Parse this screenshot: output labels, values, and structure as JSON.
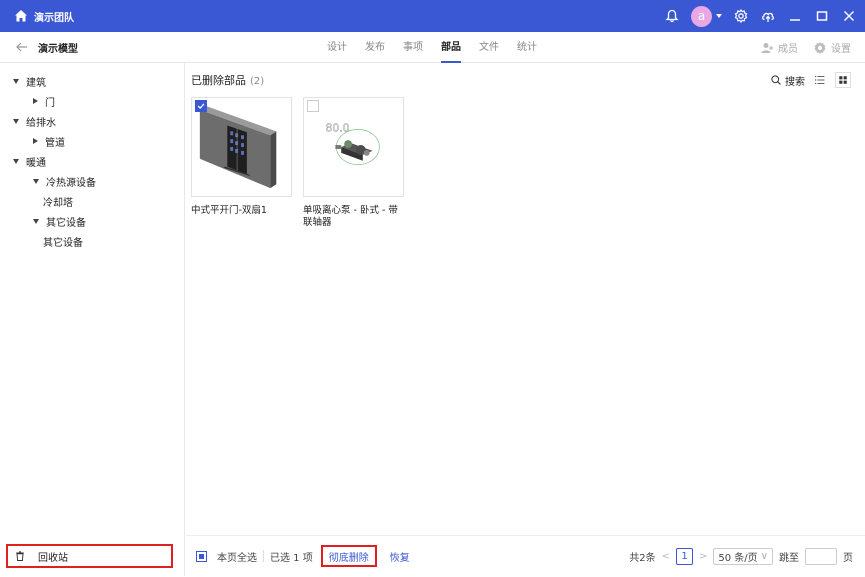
{
  "titlebar": {
    "team_name": "演示团队",
    "avatar_letter": "a",
    "icons": [
      "home-icon",
      "bell-icon",
      "chevron-down-icon",
      "gear-icon",
      "upload-cloud-icon",
      "minimize-icon",
      "maximize-icon",
      "close-icon"
    ]
  },
  "subbar": {
    "model_name": "演示模型",
    "tabs": [
      {
        "label": "设计",
        "active": false
      },
      {
        "label": "发布",
        "active": false
      },
      {
        "label": "事项",
        "active": false
      },
      {
        "label": "部品",
        "active": true
      },
      {
        "label": "文件",
        "active": false
      },
      {
        "label": "统计",
        "active": false
      }
    ],
    "members_label": "成员",
    "settings_label": "设置"
  },
  "sidebar": {
    "tree": [
      {
        "label": "建筑",
        "depth": 0,
        "expanded": true
      },
      {
        "label": "门",
        "depth": 1,
        "expanded": false
      },
      {
        "label": "给排水",
        "depth": 0,
        "expanded": true
      },
      {
        "label": "管道",
        "depth": 1,
        "expanded": false
      },
      {
        "label": "暖通",
        "depth": 0,
        "expanded": true
      },
      {
        "label": "冷热源设备",
        "depth": 1,
        "expanded": true
      },
      {
        "label": "冷却塔",
        "depth": 2,
        "leaf": true
      },
      {
        "label": "其它设备",
        "depth": 1,
        "expanded": true
      },
      {
        "label": "其它设备",
        "depth": 2,
        "leaf": true
      }
    ],
    "recycle_label": "回收站"
  },
  "main": {
    "heading": "已删除部品",
    "count": "(2)",
    "search_label": "搜索",
    "items": [
      {
        "name": "中式平开门-双扇1",
        "checked": true
      },
      {
        "name": "单吸离心泵 - 卧式 - 带联轴器",
        "checked": false
      }
    ],
    "thumb_label": "80.0"
  },
  "footer": {
    "select_all": "本页全选",
    "selected": "已选 1 项",
    "delete_label": "彻底删除",
    "restore_label": "恢复",
    "total": "共2条",
    "current_page": "1",
    "page_size": "50 条/页",
    "jump_label": "跳至",
    "page_unit": "页"
  }
}
